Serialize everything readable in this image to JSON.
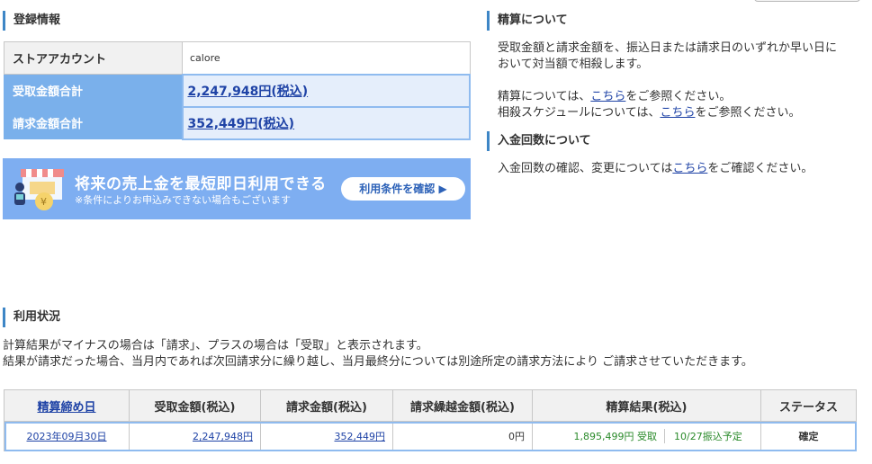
{
  "registration": {
    "heading": "登録情報",
    "rows": [
      {
        "label": "ストアアカウント",
        "value": "calore"
      },
      {
        "label": "受取金額合計",
        "value": "2,247,948円(税込)"
      },
      {
        "label": "請求金額合計",
        "value": "352,449円(税込)"
      }
    ]
  },
  "banner": {
    "main": "将来の売上金を最短即日利用できる",
    "sub": "※条件によりお申込みできない場合もございます",
    "button": "利用条件を確認 ▶"
  },
  "settlement_info": {
    "heading": "精算について",
    "text1": "受取金額と請求金額を、振込日または請求日のいずれか早い日に",
    "text2": "おいて対当額で相殺します。",
    "line3_pre": "精算については、",
    "line3_link": "こちら",
    "line3_post": "をご参照ください。",
    "line4_pre": "相殺スケジュールについては、",
    "line4_link": "こちら",
    "line4_post": "をご参照ください。"
  },
  "deposit_info": {
    "heading": "入金回数について",
    "pre": "入金回数の確認、変更については",
    "link": "こちら",
    "post": "をご確認ください。"
  },
  "usage": {
    "heading": "利用状況",
    "note1": "計算結果がマイナスの場合は「請求」、プラスの場合は「受取」と表示されます。",
    "note2": "結果が請求だった場合、当月内であれば次回請求分に繰り越し、当月最終分については別途所定の請求方法により ご請求させていただきます。",
    "columns": [
      "精算締め日",
      "受取金額(税込)",
      "請求金額(税込)",
      "請求繰越金額(税込)",
      "精算結果(税込)",
      "ステータス"
    ],
    "rows": [
      {
        "date": "2023年09月30日",
        "received": "2,247,948円",
        "billed": "352,449円",
        "carryover": "0円",
        "result": "1,895,499円 受取",
        "schedule": "10/27振込予定",
        "status": "確定"
      }
    ]
  },
  "colors": {
    "accent": "#3e86c6",
    "banner_bg": "#7eaef1",
    "link": "#1f43a6",
    "result_green": "#2a8a2a"
  }
}
